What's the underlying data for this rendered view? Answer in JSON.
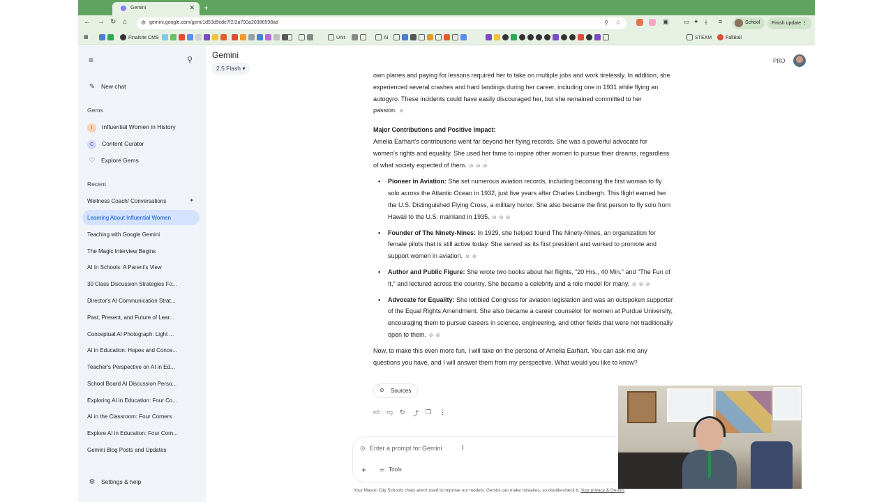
{
  "browser": {
    "tab_title": "Gemini",
    "url": "gemini.google.com/gem/1d53d9cde7f2/2a790a20386598ad",
    "profile_label": "School",
    "update_label": "Finish update",
    "bookmarks": [
      "Finalsite CMS",
      "Unit",
      "AI",
      "STEAM",
      "FallBall"
    ]
  },
  "sidebar": {
    "new_chat": "New chat",
    "gems_heading": "Gems",
    "gems": [
      {
        "initial": "I",
        "label": "Influential Women in History",
        "color": "#f6d3b6"
      },
      {
        "initial": "C",
        "label": "Content Curator",
        "color": "#d4d8f7"
      }
    ],
    "explore_gems": "Explore Gems",
    "recent_heading": "Recent",
    "recent": [
      "Wellness Coach/ Conversations",
      "Learning About Influential Women",
      "Teaching with Google Gemini",
      "The Magic Interview Begins",
      "AI In Schools: A Parent's View",
      "30 Class Discussion Strategies Fo...",
      "Director's AI Communication Strat...",
      "Past, Present, and Future of Lear...",
      "Conceptual AI Photograph: Light ...",
      "AI in Education: Hopes and Conce...",
      "Teacher's Perspective on AI in Ed...",
      "School Board AI Discussion Perso...",
      "Exploring AI in Education: Four Co...",
      "AI in the Classroom: Four Corners",
      "Explore AI in Education: Four Corn...",
      "Gemini Blog Posts and Updates"
    ],
    "settings": "Settings & help"
  },
  "header": {
    "title": "Gemini",
    "model": "2.5 Flash",
    "pro_label": "PRO"
  },
  "response": {
    "intro": "own planes and paying for lessons required her to take on multiple jobs and work tirelessly. In addition, she experienced several crashes and hard landings during her career, including one in 1931 while flying an autogyro. These incidents could have easily discouraged her, but she remained committed to her passion.",
    "heading": "Major Contributions and Positive Impact:",
    "paragraph": "Amelia Earhart's contributions went far beyond her flying records. She was a powerful advocate for women's rights and equality. She used her fame to inspire other women to pursue their dreams, regardless of what society expected of them.",
    "bullets": [
      {
        "lead": "Pioneer in Aviation:",
        "text": " She set numerous aviation records, including becoming the first woman to fly solo across the Atlantic Ocean in 1932, just five years after Charles Lindbergh. This flight earned her the U.S. Distinguished Flying Cross, a military honor. She also became the first person to fly solo from Hawaii to the U.S. mainland in 1935."
      },
      {
        "lead": "Founder of The Ninety-Nines:",
        "text": " In 1929, she helped found The Ninety-Nines, an organization for female pilots that is still active today. She served as its first president and worked to promote and support women in aviation."
      },
      {
        "lead": "Author and Public Figure:",
        "text": " She wrote two books about her flights, \"20 Hrs., 40 Min.\" and \"The Fun of It,\" and lectured across the country. She became a celebrity and a role model for many."
      },
      {
        "lead": "Advocate for Equality:",
        "text": " She lobbied Congress for aviation legislation and was an outspoken supporter of the Equal Rights Amendment. She also became a career counselor for women at Purdue University, encouraging them to pursue careers in science, engineering, and other fields that were not traditionally open to them."
      }
    ],
    "closing": "Now, to make this even more fun, I will take on the persona of Amelia Earhart. You can ask me any questions you have, and I will answer them from my perspective. What would you like to know?",
    "sources_label": "Sources"
  },
  "input": {
    "placeholder": "Enter a prompt for Gemini",
    "tools_label": "Tools"
  },
  "disclaimer": {
    "text": "Your Mason City Schools chats aren't used to improve our models. Gemini can make mistakes, so double-check it.",
    "link": "Your privacy & Gemini"
  }
}
